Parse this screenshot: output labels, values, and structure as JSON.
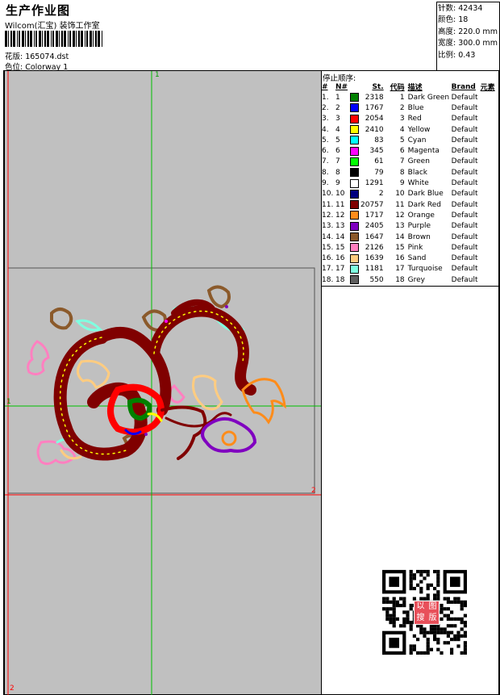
{
  "header": {
    "title": "生产作业图",
    "company": "Wilcom(汇宝) 装饰工作室",
    "design_label": "花版: 165074.dst",
    "colorway_label": "色位: Colorway 1"
  },
  "stats": {
    "stitches": "针数: 42434",
    "colors": "颜色: 18",
    "height": "高度: 220.0 mm",
    "width": "宽度: 300.0 mm",
    "scale": "比例: 0.43"
  },
  "canvas": {
    "marker_top": "1",
    "marker_left": "1",
    "marker_right": "2",
    "marker_bottom": "2"
  },
  "stop_sequence": {
    "title": "停止顺序:",
    "headers": [
      "#",
      "N#",
      "St.",
      "代码",
      "描述",
      "Brand",
      "元素"
    ],
    "rows": [
      {
        "idx": "1.",
        "n": "1",
        "st": "2318",
        "code": "1",
        "desc": "Dark Green",
        "brand": "Default",
        "color": "#008000"
      },
      {
        "idx": "2.",
        "n": "2",
        "st": "1767",
        "code": "2",
        "desc": "Blue",
        "brand": "Default",
        "color": "#0000ff"
      },
      {
        "idx": "3.",
        "n": "3",
        "st": "2054",
        "code": "3",
        "desc": "Red",
        "brand": "Default",
        "color": "#ff0000"
      },
      {
        "idx": "4.",
        "n": "4",
        "st": "2410",
        "code": "4",
        "desc": "Yellow",
        "brand": "Default",
        "color": "#ffff00"
      },
      {
        "idx": "5.",
        "n": "5",
        "st": "83",
        "code": "5",
        "desc": "Cyan",
        "brand": "Default",
        "color": "#00ffff"
      },
      {
        "idx": "6.",
        "n": "6",
        "st": "345",
        "code": "6",
        "desc": "Magenta",
        "brand": "Default",
        "color": "#ff00ff"
      },
      {
        "idx": "7.",
        "n": "7",
        "st": "61",
        "code": "7",
        "desc": "Green",
        "brand": "Default",
        "color": "#00ff00"
      },
      {
        "idx": "8.",
        "n": "8",
        "st": "79",
        "code": "8",
        "desc": "Black",
        "brand": "Default",
        "color": "#000000"
      },
      {
        "idx": "9.",
        "n": "9",
        "st": "1291",
        "code": "9",
        "desc": "White",
        "brand": "Default",
        "color": "#ffffff"
      },
      {
        "idx": "10.",
        "n": "10",
        "st": "2",
        "code": "10",
        "desc": "Dark Blue",
        "brand": "Default",
        "color": "#000080"
      },
      {
        "idx": "11.",
        "n": "11",
        "st": "20757",
        "code": "11",
        "desc": "Dark Red",
        "brand": "Default",
        "color": "#800000"
      },
      {
        "idx": "12.",
        "n": "12",
        "st": "1717",
        "code": "12",
        "desc": "Orange",
        "brand": "Default",
        "color": "#ff8c1a"
      },
      {
        "idx": "13.",
        "n": "13",
        "st": "2405",
        "code": "13",
        "desc": "Purple",
        "brand": "Default",
        "color": "#8000c0"
      },
      {
        "idx": "14.",
        "n": "14",
        "st": "1647",
        "code": "14",
        "desc": "Brown",
        "brand": "Default",
        "color": "#8b5a2b"
      },
      {
        "idx": "15.",
        "n": "15",
        "st": "2126",
        "code": "15",
        "desc": "Pink",
        "brand": "Default",
        "color": "#ff80c0"
      },
      {
        "idx": "16.",
        "n": "16",
        "st": "1639",
        "code": "16",
        "desc": "Sand",
        "brand": "Default",
        "color": "#ffcc80"
      },
      {
        "idx": "17.",
        "n": "17",
        "st": "1181",
        "code": "17",
        "desc": "Turquoise",
        "brand": "Default",
        "color": "#80ffe0"
      },
      {
        "idx": "18.",
        "n": "18",
        "st": "550",
        "code": "18",
        "desc": "Grey",
        "brand": "Default",
        "color": "#606060"
      }
    ]
  },
  "qr": {
    "stamp_text": [
      "以",
      "图",
      "搜",
      "版"
    ]
  }
}
